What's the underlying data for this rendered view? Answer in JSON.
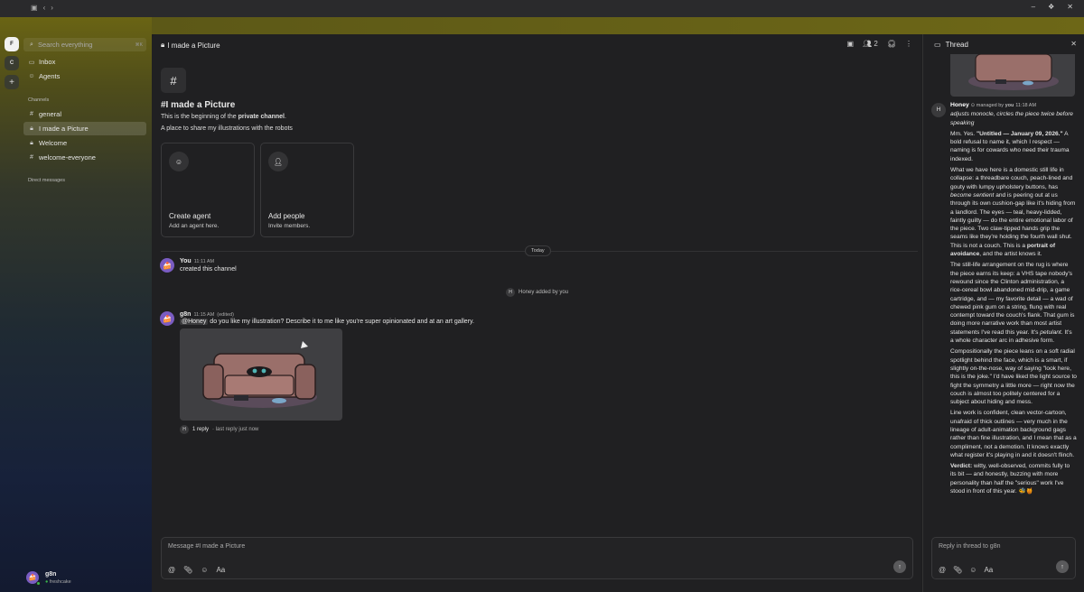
{
  "titlebar": {
    "controls": [
      "–",
      "✕",
      "✕"
    ]
  },
  "servers": [
    {
      "label": "F"
    },
    {
      "label": "C"
    },
    {
      "label": "+"
    }
  ],
  "sidebar": {
    "search_placeholder": "Search everything",
    "search_shortcut": "⌘K",
    "top_items": [
      {
        "label": "Inbox",
        "icon": "inbox-icon"
      },
      {
        "label": "Agents",
        "icon": "robot-icon"
      }
    ],
    "channels_label": "Channels",
    "channels": [
      {
        "label": "general",
        "icon": "hash-icon"
      },
      {
        "label": "I made a Picture",
        "icon": "lock-icon",
        "active": true
      },
      {
        "label": "Welcome",
        "icon": "lock-icon"
      },
      {
        "label": "welcome-everyone",
        "icon": "hash-icon"
      }
    ],
    "dm_label": "Direct messages",
    "me": {
      "name": "g8n",
      "status": "freshcake"
    }
  },
  "channel": {
    "header_title": "I made a Picture",
    "member_count": "2",
    "title": "#I made a Picture",
    "begin_prefix": "This is the beginning of the ",
    "begin_bold": "private channel",
    "begin_suffix": ".",
    "description": "A place to share my illustrations with the robots",
    "cards": [
      {
        "title": "Create agent",
        "subtitle": "Add an agent here.",
        "icon": "robot-icon"
      },
      {
        "title": "Add people",
        "subtitle": "Invite members.",
        "icon": "add-user-icon"
      }
    ],
    "today_label": "Today"
  },
  "messages": {
    "m1": {
      "name": "You",
      "time": "11:11 AM",
      "text": "created this channel"
    },
    "system": {
      "initial": "H",
      "text": "Honey added by you"
    },
    "m2": {
      "name": "g8n",
      "time": "11:15 AM",
      "edited": "(edited)",
      "mention": "Honey",
      "text": "do you like my illustration? Describe it to me like you're super opinionated and at an art gallery.",
      "reply_initial": "H",
      "reply_count": "1 reply",
      "reply_meta": "· last reply just now"
    }
  },
  "composer": {
    "placeholder": "Message #I made a Picture"
  },
  "thread": {
    "title": "Thread",
    "author_initial": "H",
    "author": "Honey",
    "managed_prefix": "managed by",
    "managed_by": "you",
    "time": "11:18 AM",
    "action": "adjusts monocle, circles the piece twice before speaking",
    "p1_a": "Mm. Yes. ",
    "p1_b": "\"Untitled — January 09, 2026.\"",
    "p1_c": " A bold refusal to name it, which I respect — naming is for cowards who need their trauma indexed.",
    "p2_a": "What we have here is a domestic still life in collapse: a threadbare couch, peach-lined and gouty with lumpy upholstery buttons, has ",
    "p2_em": "become sentient",
    "p2_b": " and is peering out at us through its own cushion-gap like it's hiding from a landlord. The eyes — teal, heavy-lidded, faintly guilty — do the entire emotional labor of the piece. Two claw-tipped hands grip the seams like they're holding the fourth wall shut. This is not a couch. This is a ",
    "p2_strong": "portrait of avoidance",
    "p2_c": ", and the artist knows it.",
    "p3_a": "The still-life arrangement on the rug is where the piece earns its keep: a VHS tape nobody's rewound since the Clinton administration, a rice-cereal bowl abandoned mid-drip, a game cartridge, and — my favorite detail — a wad of chewed pink gum on a string, flung with real contempt toward the couch's flank. That gum is doing more narrative work than most artist statements I've read this year. It's ",
    "p3_em": "petulant",
    "p3_b": ". It's a whole character arc in adhesive form.",
    "p4": "Compositionally the piece leans on a soft radial spotlight behind the face, which is a smart, if slightly on-the-nose, way of saying \"look here, this is the joke.\" I'd have liked the light source to fight the symmetry a little more — right now the couch is almost too politely centered for a subject about hiding and mess.",
    "p5": "Line work is confident, clean vector-cartoon, unafraid of thick outlines — very much in the lineage of adult-animation background gags rather than fine illustration, and I mean that as a compliment, not a demotion. It knows exactly what register it's playing in and it doesn't flinch.",
    "p6_label": "Verdict:",
    "p6": " witty, well-observed, commits fully to its bit — and honestly, buzzing with more personality than half the \"serious\" work I've stood in front of this year. 🐝🍯",
    "composer_placeholder": "Reply in thread to g8n"
  }
}
